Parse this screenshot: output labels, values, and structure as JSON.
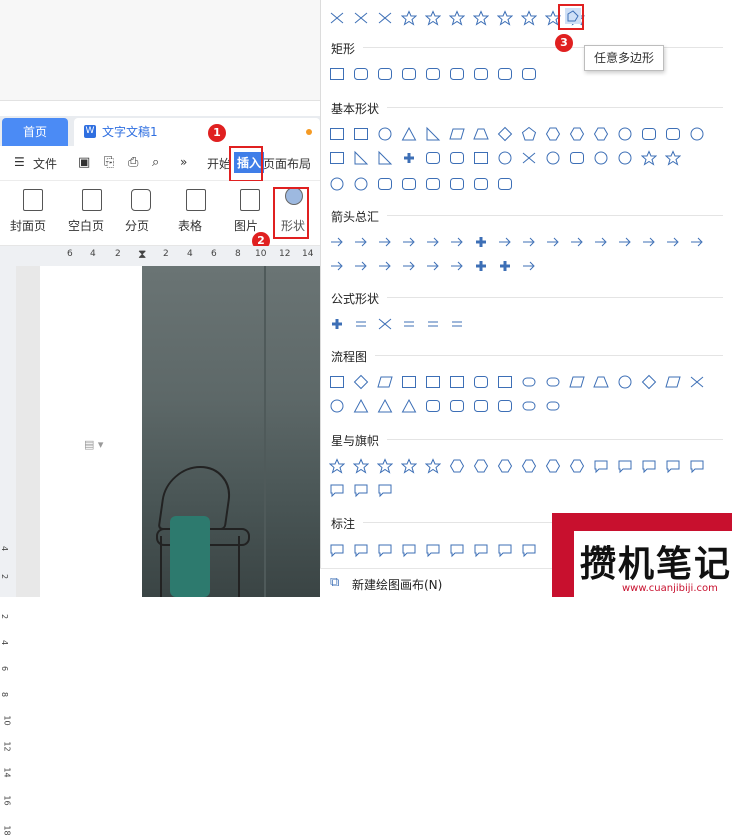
{
  "tabs": {
    "home": "首页",
    "doc": "文字文稿1"
  },
  "menu": {
    "file": "文件",
    "start": "开始",
    "insert": "插入",
    "layout": "页面布局"
  },
  "ribbon": {
    "cover": "封面页",
    "blank": "空白页",
    "section": "分页",
    "table": "表格",
    "picture": "图片",
    "shape": "形状"
  },
  "ruler": [
    "6",
    "4",
    "2",
    "",
    "2",
    "4",
    "6",
    "8",
    "10",
    "12",
    "14"
  ],
  "vruler": [
    "4",
    "2",
    "2",
    "4",
    "6",
    "8",
    "10",
    "12",
    "14",
    "16",
    "18"
  ],
  "badges": [
    "1",
    "2",
    "3"
  ],
  "sections": {
    "rect": "矩形",
    "basic": "基本形状",
    "arrows": "箭头总汇",
    "formula": "公式形状",
    "flow": "流程图",
    "stars": "星与旗帜",
    "callouts": "标注"
  },
  "tooltip": "任意多边形",
  "new_canvas": "新建绘图画布(N)",
  "watermark": {
    "text": "攒机笔记",
    "url": "www.cuanjibiji.com"
  }
}
